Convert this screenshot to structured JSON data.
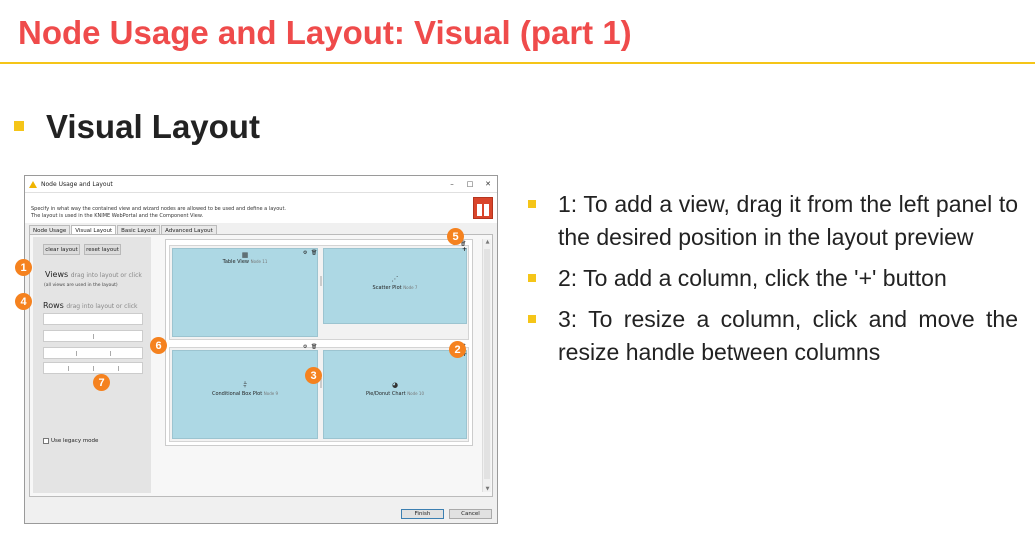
{
  "slide": {
    "title": "Node Usage and Layout: Visual (part 1)",
    "heading": "Visual Layout"
  },
  "dialog": {
    "title": "Node Usage and Layout",
    "controls": [
      "–",
      "□",
      "✕"
    ],
    "description_line1": "Specify in what way the contained view and wizard nodes are allowed to be used and define a layout.",
    "description_line2": "The layout is used in the KNIME WebPortal and the Component View.",
    "tabs": [
      "Node Usage",
      "Visual Layout",
      "Basic Layout",
      "Advanced Layout"
    ],
    "clear_layout": "clear layout",
    "reset_layout": "reset layout",
    "views_label": "Views",
    "views_sub": "drag into layout or click",
    "views_note": "(all views are used in the layout)",
    "rows_label": "Rows",
    "rows_sub": "drag into layout or click",
    "legacy_label": "Use legacy mode",
    "cells": [
      {
        "label": "Table View",
        "node": "Node 11"
      },
      {
        "label": "Scatter Plot",
        "node": "Node 7"
      },
      {
        "label": "Conditional Box Plot",
        "node": "Node 9"
      },
      {
        "label": "Pie/Donut Chart",
        "node": "Node 10"
      }
    ],
    "finish": "Finish",
    "cancel": "Cancel"
  },
  "badges": [
    "1",
    "2",
    "3",
    "4",
    "5",
    "6",
    "7"
  ],
  "bullets": [
    "1: To add a view, drag it from the left panel to the desired position in the layout preview",
    "2: To add a column, click the '+' button",
    "3: To resize a column, click and move the resize handle between columns"
  ],
  "colors": {
    "title": "#ef4b4b",
    "accent": "#f5c518",
    "badge": "#f5821f",
    "cell": "#add8e4"
  }
}
